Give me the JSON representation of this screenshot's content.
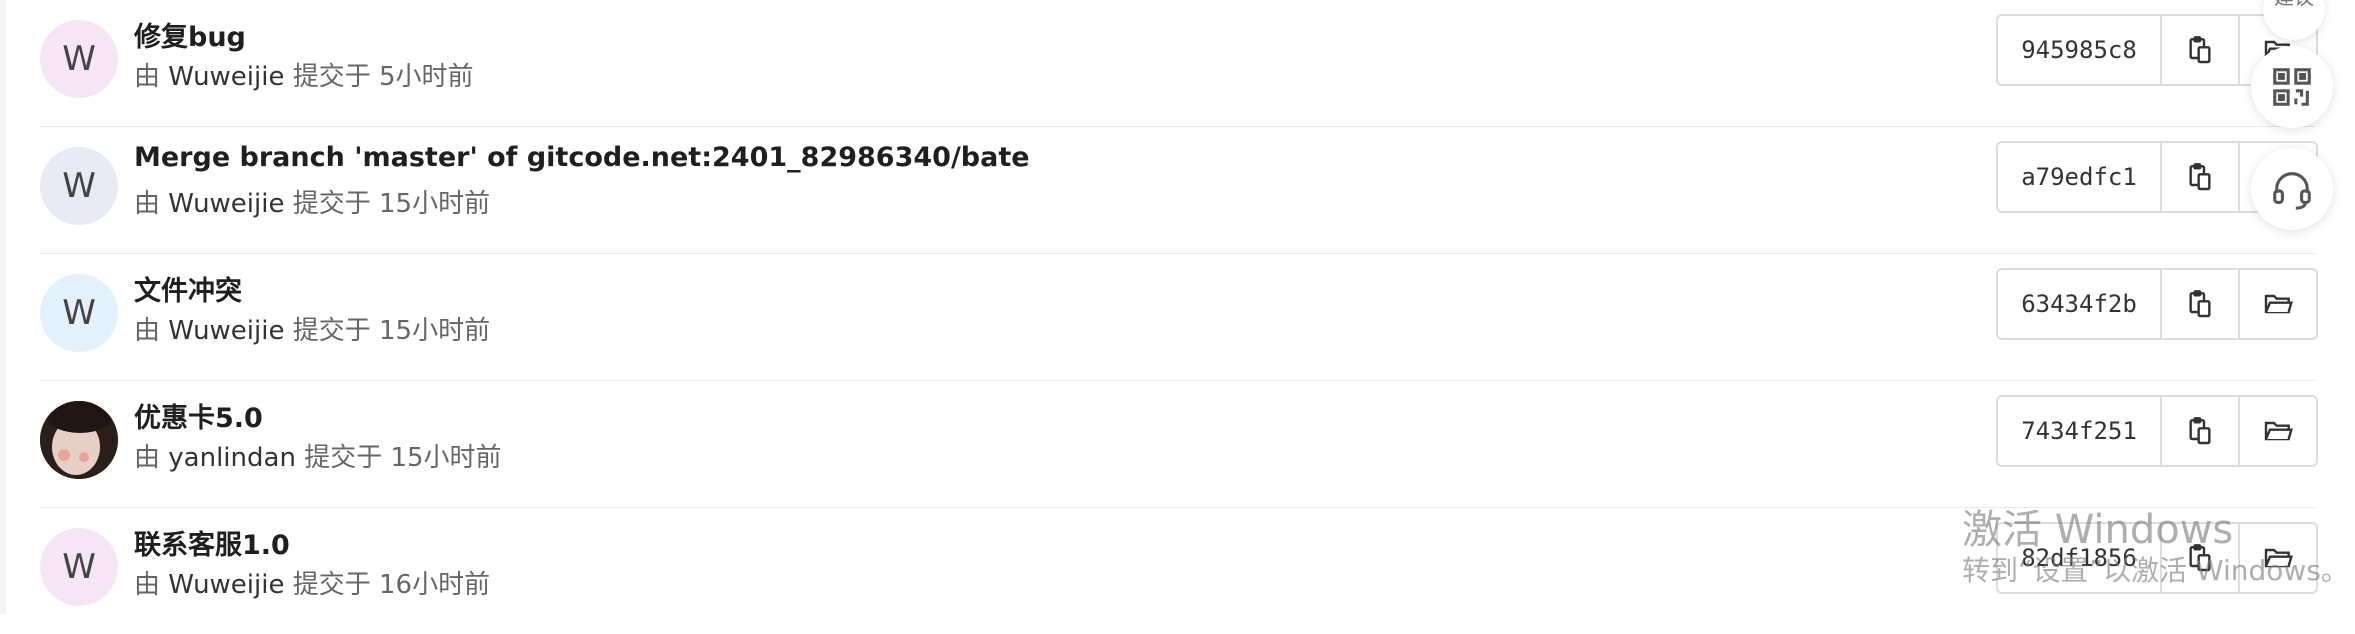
{
  "commits": [
    {
      "message": "修复bug",
      "by_prefix": "由",
      "author": "Wuweijie",
      "submitted": "提交于",
      "time": "5小时前",
      "sha": "945985c8",
      "avatar_letter": "W",
      "avatar_bg": "#f6e6f5"
    },
    {
      "message": "Merge branch 'master' of gitcode.net:2401_82986340/bate",
      "by_prefix": "由",
      "author": "Wuweijie",
      "submitted": "提交于",
      "time": "15小时前",
      "sha": "a79edfc1",
      "avatar_letter": "W",
      "avatar_bg": "#e8eaf6"
    },
    {
      "message": "文件冲突",
      "by_prefix": "由",
      "author": "Wuweijie",
      "submitted": "提交于",
      "time": "15小时前",
      "sha": "63434f2b",
      "avatar_letter": "W",
      "avatar_bg": "#e3f1fd"
    },
    {
      "message": "优惠卡5.0",
      "by_prefix": "由",
      "author": "yanlindan",
      "submitted": "提交于",
      "time": "15小时前",
      "sha": "7434f251",
      "avatar_letter": "",
      "avatar_bg": "#3a2a26"
    },
    {
      "message": "联系客服1.0",
      "by_prefix": "由",
      "author": "Wuweijie",
      "submitted": "提交于",
      "time": "16小时前",
      "sha": "82df1856",
      "avatar_letter": "W",
      "avatar_bg": "#f6e6f5"
    }
  ],
  "floating": {
    "suggest_label": "建议"
  },
  "watermark": {
    "title": "激活 Windows",
    "subtitle": "转到“设置”以激活 Windows。"
  },
  "icons": {
    "copy": "clipboard-icon",
    "browse": "folder-open-icon",
    "qr": "qr-code-icon",
    "support": "headset-icon"
  }
}
